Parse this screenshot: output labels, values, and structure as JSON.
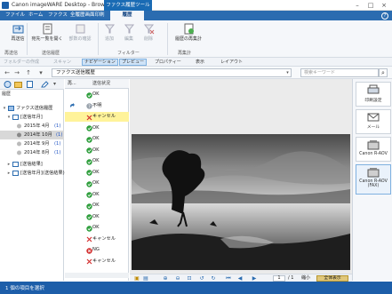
{
  "window": {
    "title": "Canon imageWARE Desktop - Browser",
    "context_tab": "ファクス履歴ツール"
  },
  "ribbon_tabs": [
    "ファイル",
    "ホーム",
    "ファクス",
    "全履歴画面印刷",
    "履歴"
  ],
  "ribbon": {
    "buttons": [
      {
        "label": "再送信"
      },
      {
        "label": "宛先一覧を開く"
      },
      {
        "label": "部数の確認"
      },
      {
        "label": "追加"
      },
      {
        "label": "編集"
      },
      {
        "label": "削除"
      },
      {
        "label": "履歴の再集計"
      }
    ],
    "groups": [
      "再送信",
      "送信履歴",
      "フィルター",
      "再集計"
    ]
  },
  "view_toolbar": {
    "folder_up": "フォルダーの作成",
    "scan": "スキャン",
    "navigation": "ナビゲーション",
    "preview": "プレビュー",
    "properties": "プロパティー",
    "display": "表示",
    "layout": "レイアウト"
  },
  "address": {
    "path": "ファクス送信履歴",
    "search_placeholder": "検索キーワード"
  },
  "tree": {
    "header": "履歴",
    "items": [
      {
        "label": "ファクス送信履歴",
        "count": ""
      },
      {
        "label": "[送信年月]",
        "count": ""
      },
      {
        "label": "2015年 4月",
        "count": "(1)"
      },
      {
        "label": "2014年 10月",
        "count": "(1)"
      },
      {
        "label": "2014年 9月",
        "count": "(1)"
      },
      {
        "label": "2014年 8月",
        "count": "(1)"
      },
      {
        "label": "[送信結果]",
        "count": ""
      },
      {
        "label": "[送信年月](送信結果)",
        "count": ""
      }
    ]
  },
  "list": {
    "col1": "再...",
    "col2": "送信状況",
    "rows": [
      {
        "status": "ok",
        "label": "OK"
      },
      {
        "status": "warn",
        "label": "不明"
      },
      {
        "status": "cancel",
        "label": "キャンセル"
      },
      {
        "status": "ok",
        "label": "OK"
      },
      {
        "status": "ok",
        "label": "OK"
      },
      {
        "status": "ok",
        "label": "OK"
      },
      {
        "status": "ok",
        "label": "OK"
      },
      {
        "status": "ok",
        "label": "OK"
      },
      {
        "status": "ok",
        "label": "OK"
      },
      {
        "status": "ok",
        "label": "OK"
      },
      {
        "status": "ok",
        "label": "OK"
      },
      {
        "status": "ok",
        "label": "OK"
      },
      {
        "status": "ok",
        "label": "OK"
      },
      {
        "status": "cancel",
        "label": "キャンセル"
      },
      {
        "status": "ng",
        "label": "NG"
      },
      {
        "status": "cancel",
        "label": "キャンセル"
      }
    ]
  },
  "right_pane": {
    "print_settings": "印刷設定",
    "mail": "メール",
    "canon_aov": "Canon R-AOV",
    "canon_aov_fax": "Canon R-AOV (FAX)"
  },
  "bottom_toolbar": {
    "page": "1",
    "total": "/ 1",
    "zoom_label": "縮小",
    "zoom_value": "全体表示"
  },
  "status_bar": {
    "text": "1 個の項目を選択"
  },
  "colors": {
    "accent": "#2b6cb0",
    "status_bar": "#1d5ea9",
    "selection": "#fff39a",
    "ok": "#2e9e3c",
    "ng": "#d32f2f"
  }
}
